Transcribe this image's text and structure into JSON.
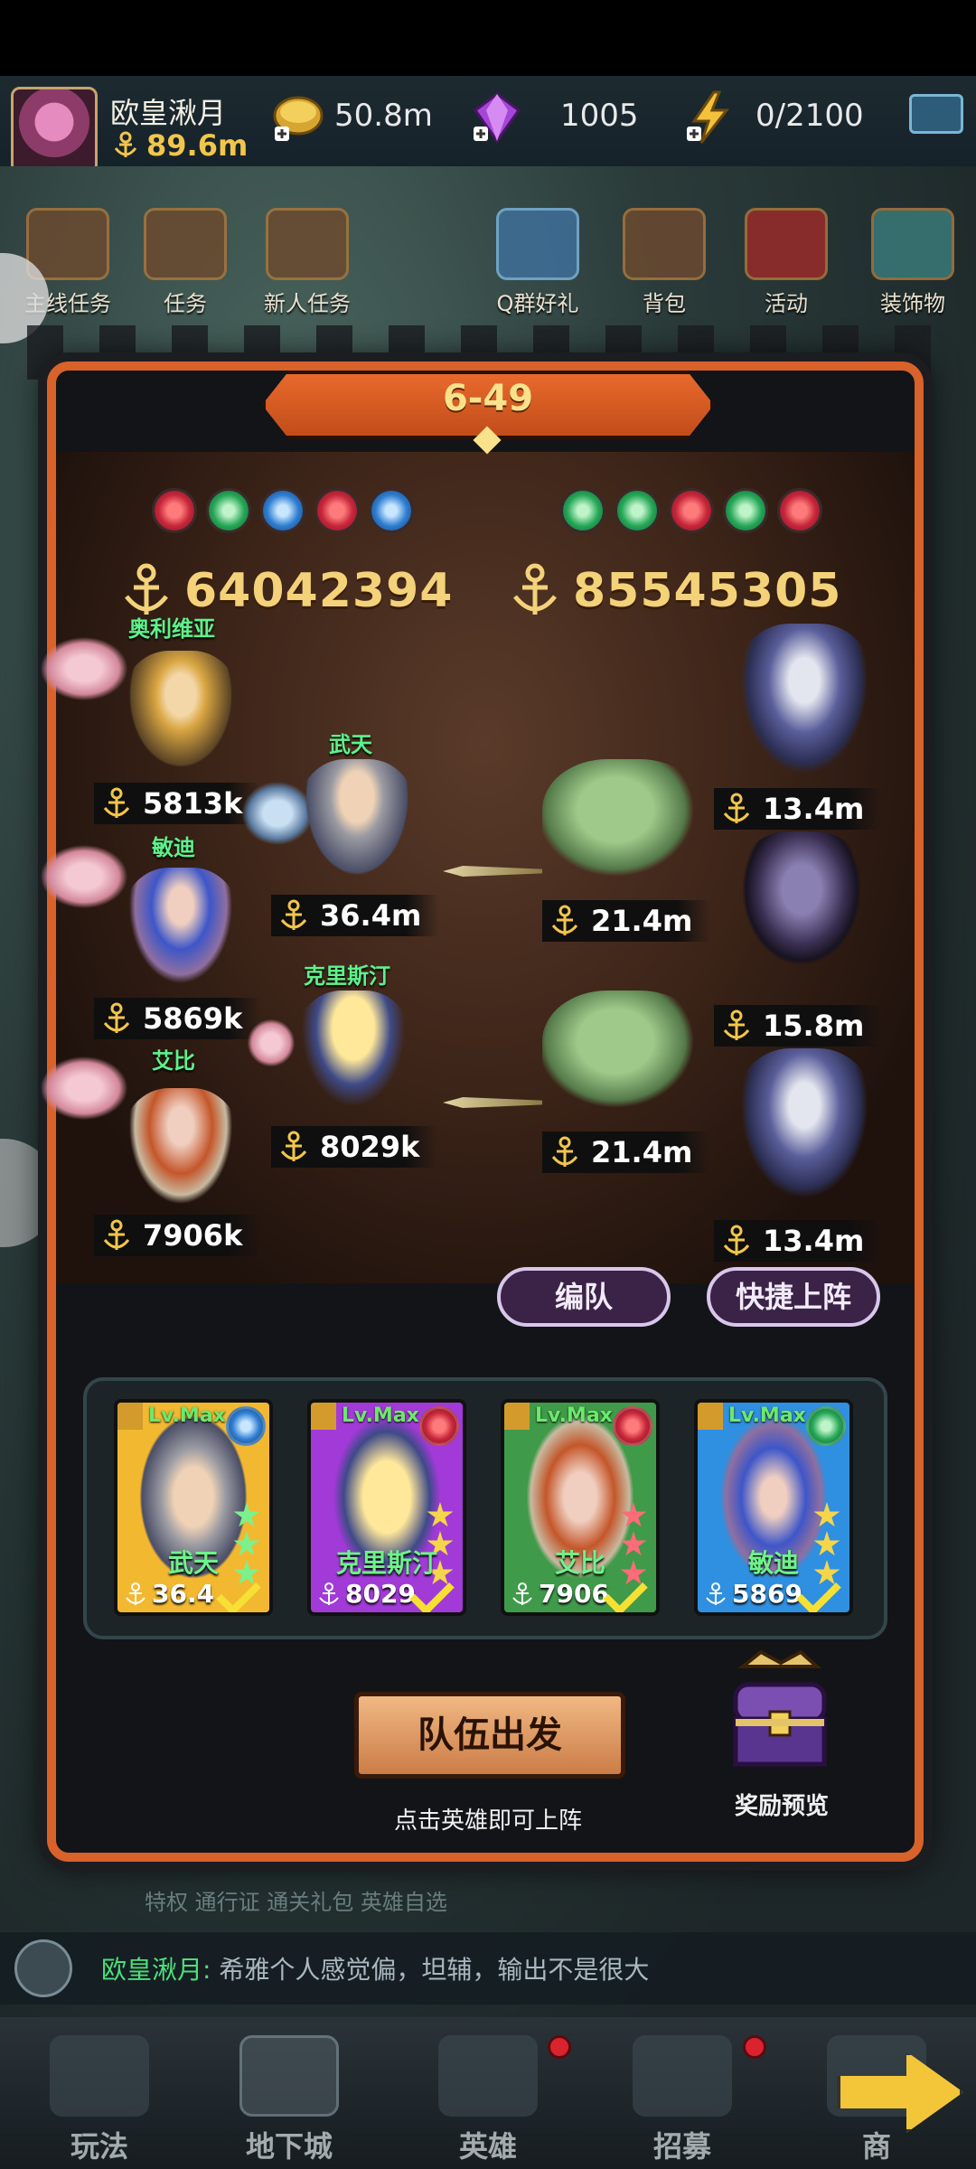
{
  "player": {
    "name": "欧皇湫月",
    "power": "89.6m"
  },
  "resources": {
    "gold": "50.8m",
    "gems": "1005",
    "stamina": "0/2100"
  },
  "town_menu": [
    {
      "label": "主线任务"
    },
    {
      "label": "任务"
    },
    {
      "label": "新人任务"
    },
    {
      "label": "Q群好礼"
    },
    {
      "label": "背包"
    },
    {
      "label": "活动"
    },
    {
      "label": "装饰物"
    }
  ],
  "stage": {
    "title": "6-49"
  },
  "elements": {
    "left": [
      "fire",
      "wind",
      "water",
      "fire",
      "water"
    ],
    "right": [
      "wind",
      "wind",
      "fire",
      "wind",
      "fire"
    ]
  },
  "team_power": {
    "player": "64042394",
    "enemy": "85545305"
  },
  "player_units": [
    {
      "name": "奥利维亚",
      "power": "5813k"
    },
    {
      "name": "武天",
      "power": "36.4m"
    },
    {
      "name": "敏迪",
      "power": "5869k"
    },
    {
      "name": "克里斯汀",
      "power": "8029k"
    },
    {
      "name": "艾比",
      "power": "7906k"
    }
  ],
  "enemy_units": [
    {
      "power": "13.4m"
    },
    {
      "power": "21.4m"
    },
    {
      "power": "15.8m"
    },
    {
      "power": "21.4m"
    },
    {
      "power": "13.4m"
    }
  ],
  "buttons": {
    "formation": "编队",
    "quick_deploy": "快捷上阵",
    "depart": "队伍出发",
    "reward_preview": "奖励预览"
  },
  "hint": "点击英雄即可上阵",
  "cards": [
    {
      "level": "Lv.Max",
      "name": "武天",
      "power": "36.4",
      "element": "water",
      "frame": "#f2b830"
    },
    {
      "level": "Lv.Max",
      "name": "克里斯汀",
      "power": "8029",
      "element": "fire",
      "frame": "#a23ad8"
    },
    {
      "level": "Lv.Max",
      "name": "艾比",
      "power": "7906",
      "element": "fire",
      "frame": "#3f9a4a"
    },
    {
      "level": "Lv.Max",
      "name": "敏迪",
      "power": "5869",
      "element": "wind",
      "frame": "#2f8fe0"
    }
  ],
  "bg_strip": "特权    通行证    通关礼包    英雄自选",
  "chat": {
    "user": "欧皇湫月:",
    "message": "希雅个人感觉偏，坦辅，输出不是很大"
  },
  "nav": [
    {
      "label": "玩法"
    },
    {
      "label": "地下城"
    },
    {
      "label": "英雄"
    },
    {
      "label": "招募"
    },
    {
      "label": "商"
    }
  ]
}
